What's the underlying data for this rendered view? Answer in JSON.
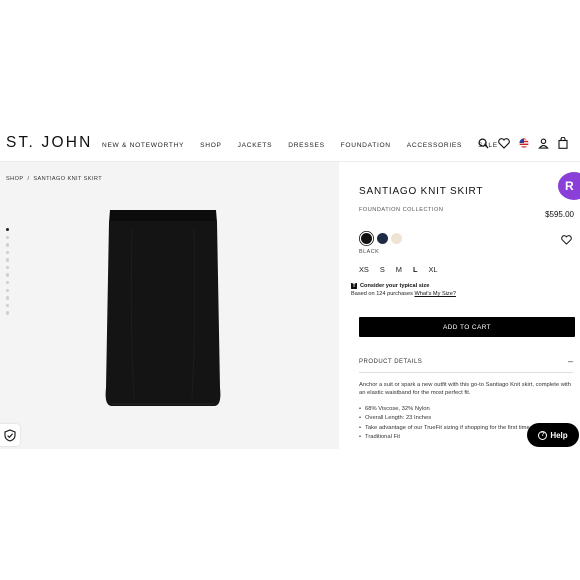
{
  "header": {
    "logo": "ST. JOHN",
    "nav": [
      "NEW & NOTEWORTHY",
      "SHOP",
      "JACKETS",
      "DRESSES",
      "FOUNDATION",
      "ACCESSORIES",
      "SALE"
    ],
    "icons": [
      "search-icon",
      "heart-icon",
      "flag-us-icon",
      "user-icon",
      "bag-icon"
    ]
  },
  "breadcrumb": {
    "items": [
      "SHOP",
      "/",
      "SANTIAGO KNIT SKIRT"
    ]
  },
  "gallery": {
    "image_count": 12,
    "active_index": 0
  },
  "product": {
    "title": "SANTIAGO KNIT SKIRT",
    "collection": "FOUNDATION COLLECTION",
    "price": "$595.00",
    "badge": "R",
    "colors": [
      {
        "name": "BLACK",
        "hex": "#111111"
      },
      {
        "name": "navy",
        "hex": "#1e2b45"
      },
      {
        "name": "cream",
        "hex": "#efe3d4"
      }
    ],
    "selected_color": "BLACK",
    "sizes": [
      "XS",
      "S",
      "M",
      "L",
      "XL"
    ],
    "selected_size": "L",
    "fit_icon": "T",
    "fit_heading": "Consider your typical size",
    "fit_sub": "Based on 124 purchases",
    "fit_link": "What's My Size?",
    "add_to_cart": "ADD TO CART",
    "details_label": "PRODUCT DETAILS",
    "details_toggle": "–",
    "description": "Anchor a suit or spark a new outfit with this go-to Santiago Knit skirt, complete with an elastic waistband for the most perfect fit.",
    "bullets": [
      "68% Viscose, 32% Nylon",
      "Overall Length: 23 Inches",
      "Take advantage of our TrueFit sizing if shopping for the first time",
      "Traditional Fit"
    ]
  },
  "help": {
    "label": "Help",
    "icon_text": "?"
  },
  "colors": {
    "accent": "#8a3fd8",
    "cta": "#000000"
  }
}
